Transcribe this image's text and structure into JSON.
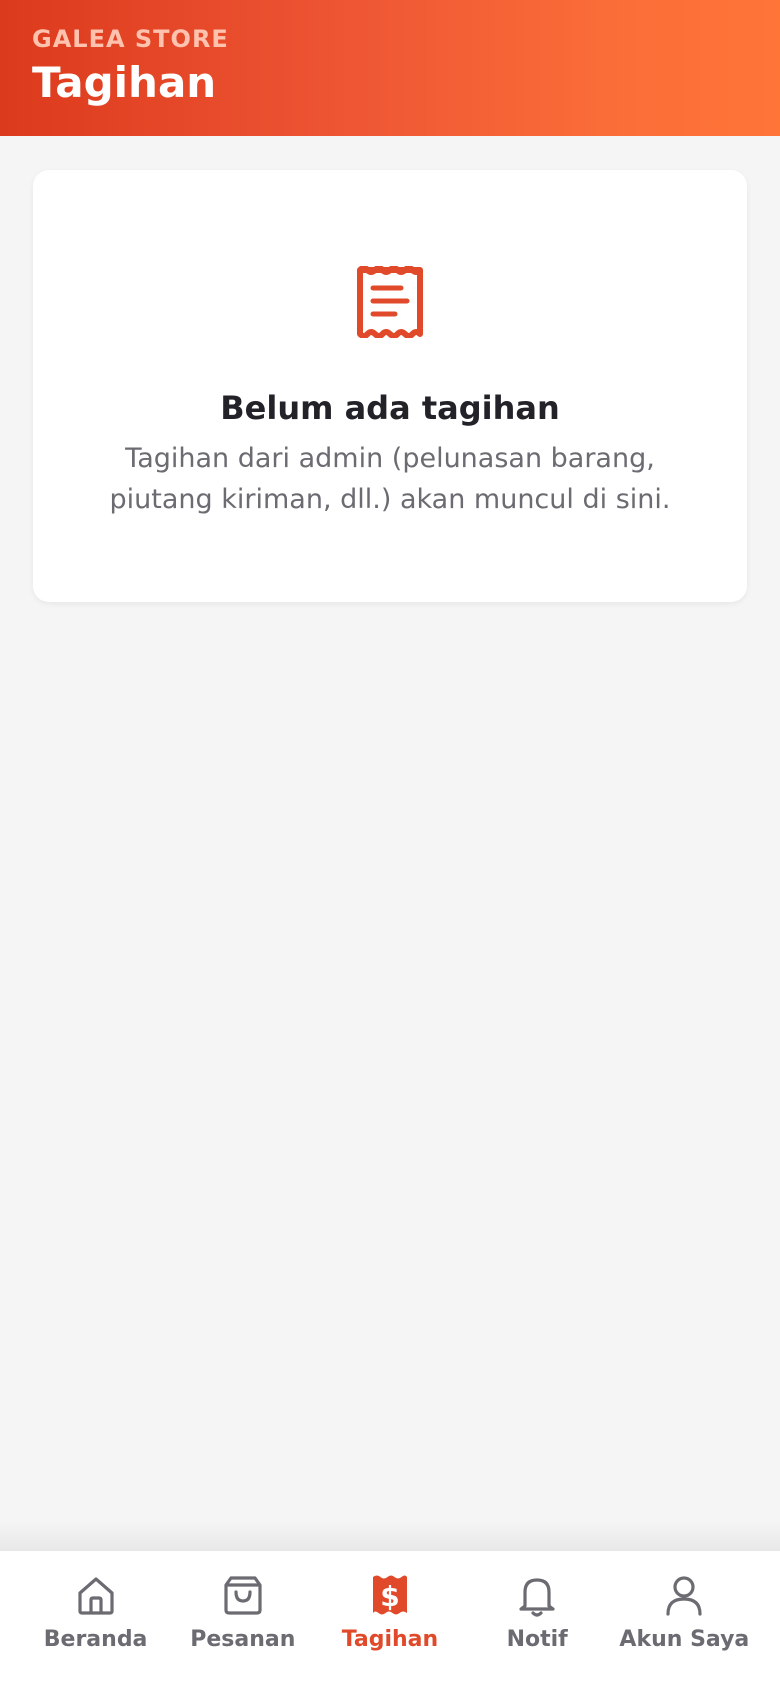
{
  "header": {
    "store_name": "GALEA STORE",
    "title": "Tagihan"
  },
  "empty_state": {
    "icon": "receipt-icon",
    "title": "Belum ada tagihan",
    "description_line1": "Tagihan dari admin (pelunasan barang,",
    "description_line2": "piutang kiriman, dll.) akan muncul di sini."
  },
  "bottom_nav": {
    "items": [
      {
        "label": "Beranda",
        "icon": "home-icon",
        "active": false
      },
      {
        "label": "Pesanan",
        "icon": "shopping-bag-icon",
        "active": false
      },
      {
        "label": "Tagihan",
        "icon": "bill-dollar-icon",
        "active": true
      },
      {
        "label": "Notif",
        "icon": "bell-icon",
        "active": false
      },
      {
        "label": "Akun Saya",
        "icon": "user-icon",
        "active": false
      }
    ]
  },
  "colors": {
    "accent": "#e04a2b",
    "header_gradient_start": "#dc3a1c",
    "header_gradient_end": "#ff7538",
    "inactive": "#6b6b72",
    "background": "#f5f5f5"
  }
}
